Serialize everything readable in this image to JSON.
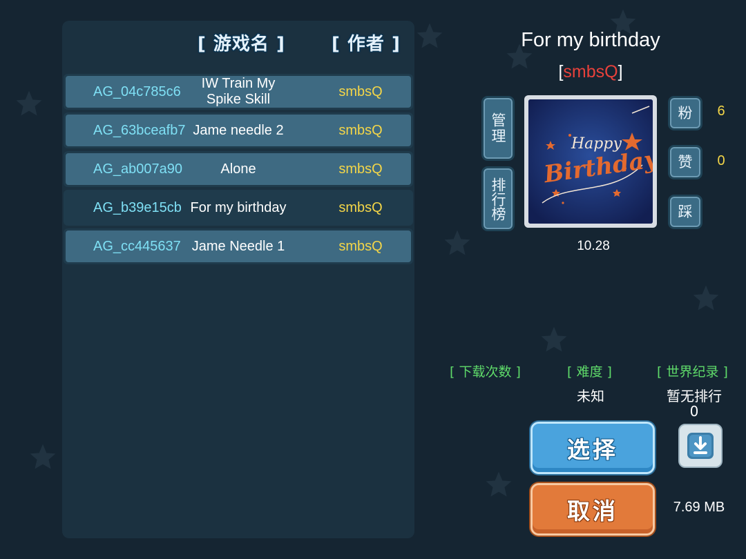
{
  "list": {
    "header_name": "[ 游戏名 ]",
    "header_author": "[ 作者 ]",
    "rows": [
      {
        "id": "AG_04c785c6",
        "name": "IW Train My Spike Skill",
        "author": "smbsQ"
      },
      {
        "id": "AG_63bceafb7",
        "name": "Jame needle 2",
        "author": "smbsQ"
      },
      {
        "id": "AG_ab007a90",
        "name": "Alone",
        "author": "smbsQ"
      },
      {
        "id": "AG_b39e15cb",
        "name": "For my birthday",
        "author": "smbsQ"
      },
      {
        "id": "AG_cc445637",
        "name": "Jame Needle 1",
        "author": "smbsQ"
      }
    ]
  },
  "detail": {
    "title": "For my birthday",
    "author_open": "[",
    "author": "smbsQ",
    "author_close": "]",
    "manage_label": "管理",
    "rank_label": "排行榜",
    "fans_label": "粉",
    "fans_count": "6",
    "like_label": "赞",
    "like_count": "0",
    "dislike_label": "踩",
    "date": "10.28",
    "thumbnail_text_1": "Happy",
    "thumbnail_text_2": "Birthday",
    "downloads_label": "[ 下载次数 ]",
    "difficulty_label": "[ 难度 ]",
    "difficulty_value": "未知",
    "record_label": "[ 世界纪录 ]",
    "record_value": "暂无排行",
    "record_value_2": "0",
    "select_button": "选择",
    "cancel_button": "取消",
    "file_size": "7.69 MB"
  },
  "colors": {
    "background": "#152532",
    "row": "#3e6a82",
    "id_text": "#7fe0f5",
    "author_text": "#f4d648",
    "author_highlight": "#e8413b",
    "label_green": "#5fdb6a",
    "select_blue": "#4aa3dd",
    "cancel_orange": "#e27a3a"
  },
  "icons": {
    "download": "download-icon",
    "background": "star-icon"
  }
}
